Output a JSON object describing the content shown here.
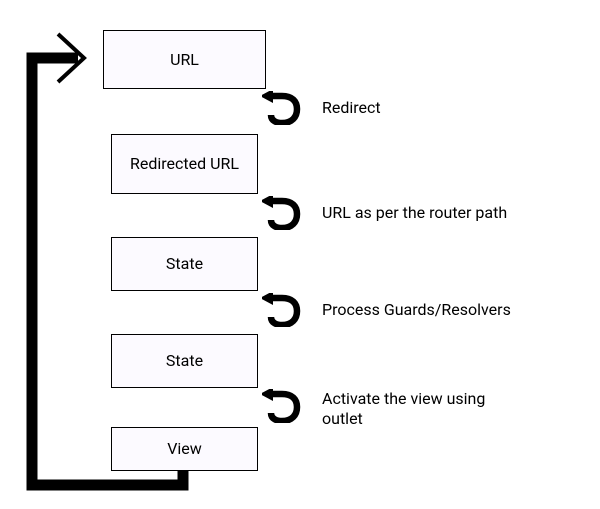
{
  "nodes": {
    "url": "URL",
    "redirected_url": "Redirected URL",
    "state1": "State",
    "state2": "State",
    "view": "View"
  },
  "transitions": {
    "t1": "Redirect",
    "t2": "URL as per the router path",
    "t3": "Process Guards/Resolvers",
    "t4": "Activate the view using outlet"
  }
}
